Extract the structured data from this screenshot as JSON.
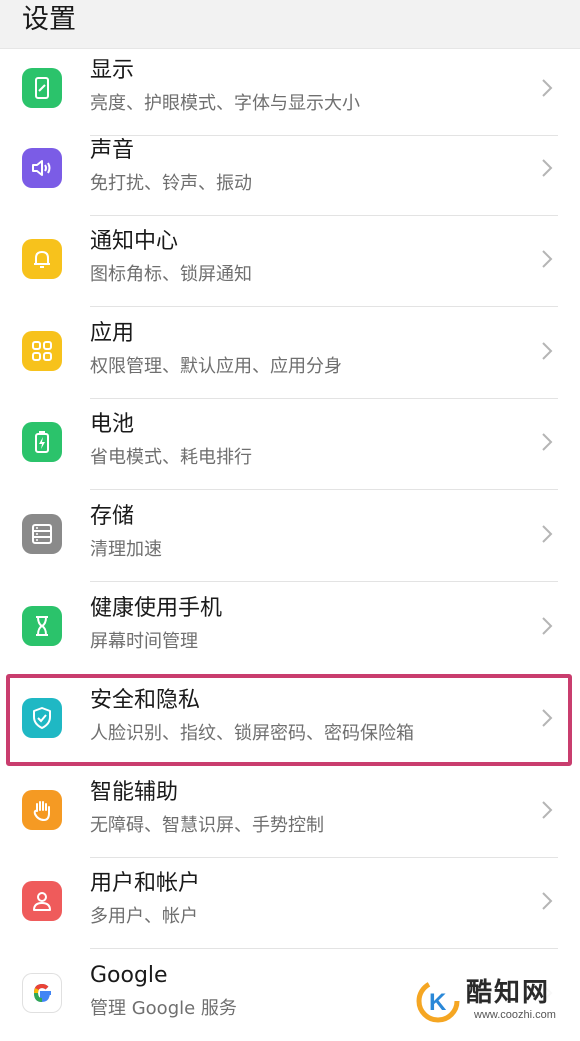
{
  "header": {
    "title": "设置"
  },
  "items": [
    {
      "title": "显示",
      "subtitle": "亮度、护眼模式、字体与显示大小",
      "icon": "display-icon",
      "color": "#2bc36b"
    },
    {
      "title": "声音",
      "subtitle": "免打扰、铃声、振动",
      "icon": "speaker-icon",
      "color": "#7b5ce6"
    },
    {
      "title": "通知中心",
      "subtitle": "图标角标、锁屏通知",
      "icon": "bell-icon",
      "color": "#f7c21c"
    },
    {
      "title": "应用",
      "subtitle": "权限管理、默认应用、应用分身",
      "icon": "apps-grid-icon",
      "color": "#f7c21c"
    },
    {
      "title": "电池",
      "subtitle": "省电模式、耗电排行",
      "icon": "battery-icon",
      "color": "#2bc36b"
    },
    {
      "title": "存储",
      "subtitle": "清理加速",
      "icon": "storage-icon",
      "color": "#8a8a8a"
    },
    {
      "title": "健康使用手机",
      "subtitle": "屏幕时间管理",
      "icon": "hourglass-icon",
      "color": "#2bc36b"
    },
    {
      "title": "安全和隐私",
      "subtitle": "人脸识别、指纹、锁屏密码、密码保险箱",
      "icon": "shield-icon",
      "color": "#1fb8c4"
    },
    {
      "title": "智能辅助",
      "subtitle": "无障碍、智慧识屏、手势控制",
      "icon": "hand-icon",
      "color": "#f59a23"
    },
    {
      "title": "用户和帐户",
      "subtitle": "多用户、帐户",
      "icon": "user-icon",
      "color": "#ef5b5b"
    },
    {
      "title": "Google",
      "subtitle": "管理 Google 服务",
      "icon": "google-icon",
      "color": "#ffffff"
    }
  ],
  "watermark": {
    "name": "酷知网",
    "url": "www.coozhi.com"
  }
}
